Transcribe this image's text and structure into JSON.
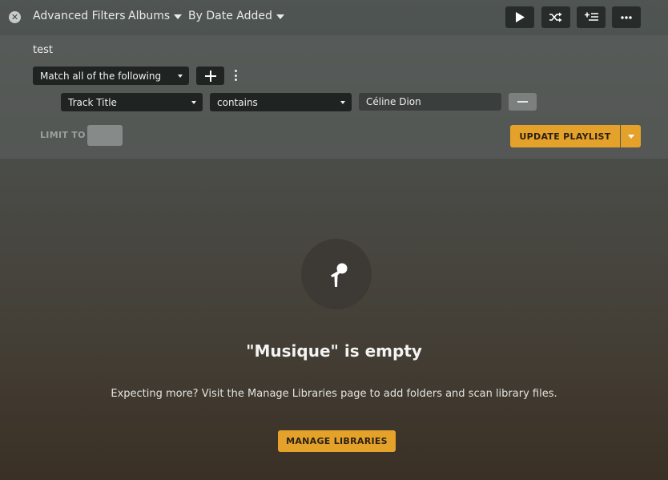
{
  "header": {
    "title": "Advanced Filters",
    "type_dropdown": "Albums",
    "sort_dropdown": "By Date Added",
    "icons": [
      "close-icon",
      "play-icon",
      "shuffle-icon",
      "add-to-queue-icon",
      "more-icon"
    ]
  },
  "filter": {
    "playlist_name": "test",
    "match_select": "Match all of the following",
    "rule": {
      "field": "Track Title",
      "operator": "contains",
      "value": "Céline Dion"
    },
    "limit_label": "LIMIT TO",
    "update_button": "UPDATE PLAYLIST"
  },
  "empty_state": {
    "icon": "microphone-icon",
    "title": "\"Musique\" is empty",
    "description": "Expecting more? Visit the Manage Libraries page to add folders and scan library files.",
    "button": "MANAGE LIBRARIES"
  },
  "colors": {
    "accent": "#e5a22a",
    "button_dark": "#272b2a"
  }
}
